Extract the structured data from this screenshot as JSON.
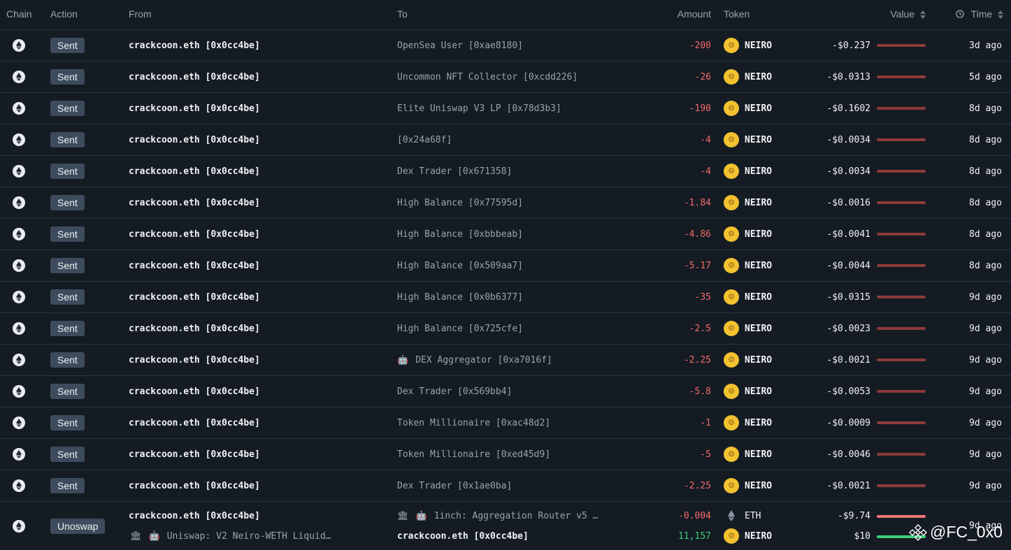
{
  "columns": {
    "chain": "Chain",
    "action": "Action",
    "from": "From",
    "to": "To",
    "amount": "Amount",
    "token": "Token",
    "value": "Value",
    "time": "Time"
  },
  "rows": [
    {
      "action": "Sent",
      "from": "crackcoon.eth [0x0cc4be]",
      "to": "OpenSea User [0xae8180]",
      "amount": "-200",
      "token": "NEIRO",
      "value": "-$0.237",
      "time": "3d ago"
    },
    {
      "action": "Sent",
      "from": "crackcoon.eth [0x0cc4be]",
      "to": "Uncommon NFT Collector [0xcdd226]",
      "amount": "-26",
      "token": "NEIRO",
      "value": "-$0.0313",
      "time": "5d ago"
    },
    {
      "action": "Sent",
      "from": "crackcoon.eth [0x0cc4be]",
      "to": "Elite Uniswap V3 LP [0x78d3b3]",
      "amount": "-190",
      "token": "NEIRO",
      "value": "-$0.1602",
      "time": "8d ago"
    },
    {
      "action": "Sent",
      "from": "crackcoon.eth [0x0cc4be]",
      "to": "[0x24a68f]",
      "amount": "-4",
      "token": "NEIRO",
      "value": "-$0.0034",
      "time": "8d ago"
    },
    {
      "action": "Sent",
      "from": "crackcoon.eth [0x0cc4be]",
      "to": "Dex Trader [0x671358]",
      "amount": "-4",
      "token": "NEIRO",
      "value": "-$0.0034",
      "time": "8d ago"
    },
    {
      "action": "Sent",
      "from": "crackcoon.eth [0x0cc4be]",
      "to": "High Balance [0x77595d]",
      "amount": "-1.84",
      "token": "NEIRO",
      "value": "-$0.0016",
      "time": "8d ago"
    },
    {
      "action": "Sent",
      "from": "crackcoon.eth [0x0cc4be]",
      "to": "High Balance [0xbbbeab]",
      "amount": "-4.86",
      "token": "NEIRO",
      "value": "-$0.0041",
      "time": "8d ago"
    },
    {
      "action": "Sent",
      "from": "crackcoon.eth [0x0cc4be]",
      "to": "High Balance [0x509aa7]",
      "amount": "-5.17",
      "token": "NEIRO",
      "value": "-$0.0044",
      "time": "8d ago"
    },
    {
      "action": "Sent",
      "from": "crackcoon.eth [0x0cc4be]",
      "to": "High Balance [0x0b6377]",
      "amount": "-35",
      "token": "NEIRO",
      "value": "-$0.0315",
      "time": "9d ago"
    },
    {
      "action": "Sent",
      "from": "crackcoon.eth [0x0cc4be]",
      "to": "High Balance [0x725cfe]",
      "amount": "-2.5",
      "token": "NEIRO",
      "value": "-$0.0023",
      "time": "9d ago"
    },
    {
      "action": "Sent",
      "from": "crackcoon.eth [0x0cc4be]",
      "to": "DEX Aggregator [0xa7016f]",
      "amount": "-2.25",
      "token": "NEIRO",
      "value": "-$0.0021",
      "time": "9d ago"
    },
    {
      "action": "Sent",
      "from": "crackcoon.eth [0x0cc4be]",
      "to": "Dex Trader [0x569bb4]",
      "amount": "-5.8",
      "token": "NEIRO",
      "value": "-$0.0053",
      "time": "9d ago"
    },
    {
      "action": "Sent",
      "from": "crackcoon.eth [0x0cc4be]",
      "to": "Token Millionaire [0xac48d2]",
      "amount": "-1",
      "token": "NEIRO",
      "value": "-$0.0009",
      "time": "9d ago"
    },
    {
      "action": "Sent",
      "from": "crackcoon.eth [0x0cc4be]",
      "to": "Token Millionaire [0xed45d9]",
      "amount": "-5",
      "token": "NEIRO",
      "value": "-$0.0046",
      "time": "9d ago"
    },
    {
      "action": "Sent",
      "from": "crackcoon.eth [0x0cc4be]",
      "to": "Dex Trader [0x1ae0ba]",
      "amount": "-2.25",
      "token": "NEIRO",
      "value": "-$0.0021",
      "time": "9d ago"
    }
  ],
  "swap_row": {
    "action": "Unoswap",
    "from_1": "crackcoon.eth [0x0cc4be]",
    "from_2": "Uniswap: V2 Neiro-WETH Liquid…",
    "to_1": "1inch: Aggregation Router v5 …",
    "to_2": "crackcoon.eth [0x0cc4be]",
    "amount_1": "-0.004",
    "token_1": "ETH",
    "value_1": "-$9.74",
    "amount_2": "11,157",
    "token_2": "NEIRO",
    "value_2": "$10",
    "time": "9d ago"
  },
  "watermark": "@FC_0x0",
  "colors": {
    "negative": "#f36a6a",
    "positive": "#3ecf7a",
    "badge": "#3d4b5c",
    "neiro": "#f2c230"
  }
}
